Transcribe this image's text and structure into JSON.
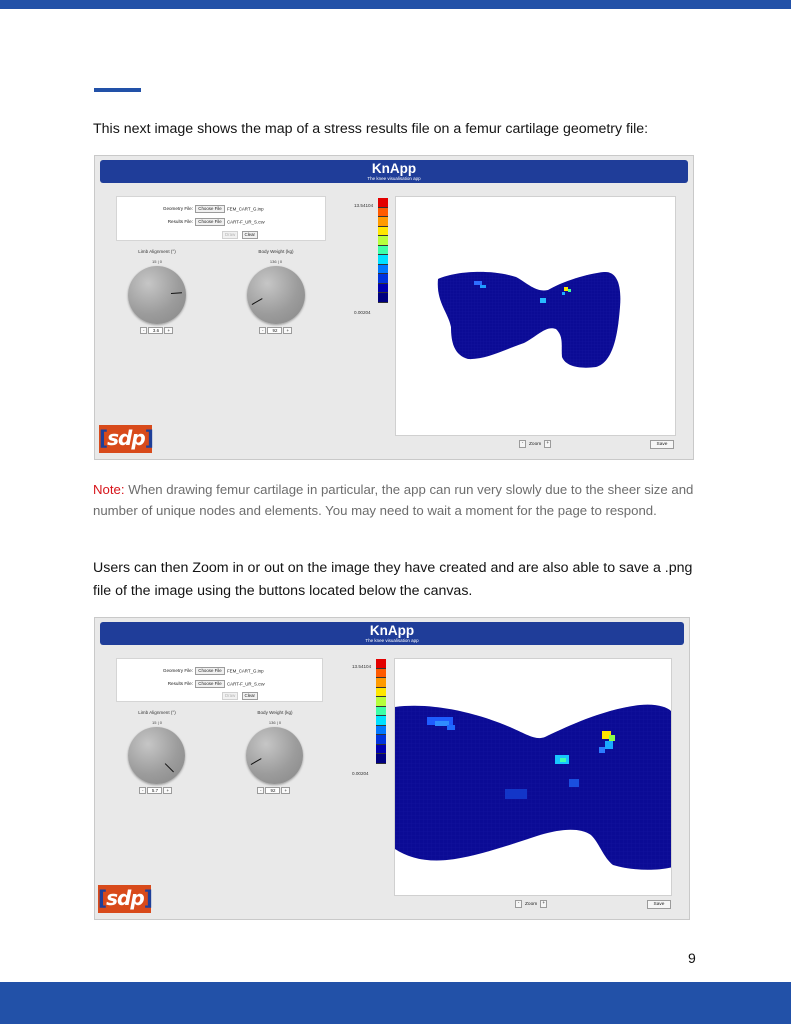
{
  "document": {
    "intro": "This next image shows the map of a stress results file on a femur cartilage geometry file:",
    "note_label": "Note:",
    "note_text": " When drawing femur cartilage in particular, the app can run very slowly due to the sheer size and number of unique nodes and elements. You may need to wait a moment for the page to respond.",
    "zoom_paragraph": "Users can then Zoom in or out on the image they have created and are also able to save a .png file of the image using the buttons located below the canvas.",
    "page_number": "9"
  },
  "screenshots": [
    {
      "app_title": "KnApp",
      "app_subtitle": "The knee visualisation app",
      "geometry_label": "Geometry File:",
      "geometry_button": "Choose File",
      "geometry_file": "FEM_CART_G.inp",
      "results_label": "Results File:",
      "results_button": "Choose File",
      "results_file": "CART-F_UR_S.csv",
      "draw_button": "Draw",
      "clear_button": "Clear",
      "limb_label": "Limb Alignment (°)",
      "limb_range": "15 | 0",
      "limb_value": "3.6",
      "weight_label": "Body Weight (kg)",
      "weight_range": "136 | 0",
      "weight_value": "92",
      "minus": "-",
      "plus": "+",
      "scale_max": "13.54104",
      "scale_min": "0.00204",
      "zoom_label": "Zoom",
      "save_label": "Save",
      "logo_text": "sdp",
      "colors": [
        "#e30000",
        "#ff5a00",
        "#ff9a00",
        "#ffe600",
        "#b6ff3c",
        "#3dffa8",
        "#00e0ff",
        "#0077ff",
        "#0033dd",
        "#0000b0",
        "#000080"
      ]
    },
    {
      "app_title": "KnApp",
      "app_subtitle": "The knee visualisation app",
      "geometry_label": "Geometry File:",
      "geometry_button": "Choose File",
      "geometry_file": "FEM_CART_G.inp",
      "results_label": "Results File:",
      "results_button": "Choose File",
      "results_file": "CART-F_UR_S.csv",
      "draw_button": "Draw",
      "clear_button": "Clear",
      "limb_label": "Limb Alignment (°)",
      "limb_range": "15 | 0",
      "limb_value": "5.7",
      "weight_label": "Body Weight (kg)",
      "weight_range": "136 | 0",
      "weight_value": "92",
      "minus": "-",
      "plus": "+",
      "scale_max": "13.54104",
      "scale_min": "0.00204",
      "zoom_label": "Zoom",
      "save_label": "Save",
      "logo_text": "sdp",
      "colors": [
        "#e30000",
        "#ff5a00",
        "#ff9a00",
        "#ffe600",
        "#b6ff3c",
        "#3dffa8",
        "#00e0ff",
        "#0077ff",
        "#0033dd",
        "#0000b0",
        "#000080"
      ]
    }
  ]
}
